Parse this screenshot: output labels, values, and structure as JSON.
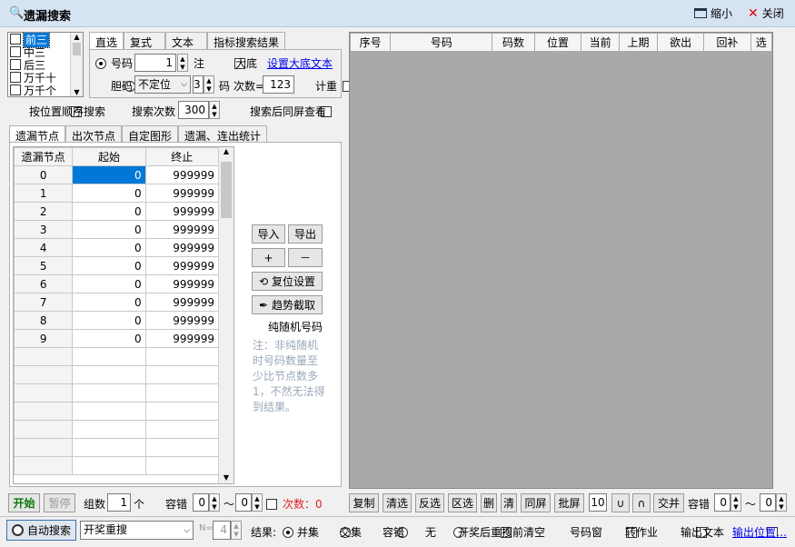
{
  "window": {
    "title": "遗漏搜索",
    "minimize_label": "缩小",
    "close_label": "关闭"
  },
  "list_items": [
    "前三",
    "中三",
    "后三",
    "万千十",
    "万千个"
  ],
  "tabs_top": [
    "直选",
    "复式",
    "文本",
    "指标搜索结果"
  ],
  "mode": {
    "code_label": "号码",
    "code_value": "1",
    "zhu_label": "注",
    "dadi_label": "大底",
    "dadi_link": "设置大底文本",
    "dan_label": "胆码",
    "dan_select": "不定位",
    "dan_num": "3",
    "ma_label": "码",
    "count_label": "次数=",
    "count_value": "123",
    "jizhong_label": "计重"
  },
  "options": {
    "order_label": "按位置顺序搜索",
    "search_count_label": "搜索次数",
    "search_count_value": "300",
    "after_label": "搜索后同屏查看"
  },
  "tabs_mid": [
    "遗漏节点",
    "出次节点",
    "自定图形",
    "遗漏、连出统计"
  ],
  "node_table": {
    "headers": [
      "遗漏节点",
      "起始",
      "终止"
    ],
    "rows": [
      [
        "0",
        "0",
        "999999"
      ],
      [
        "1",
        "0",
        "999999"
      ],
      [
        "2",
        "0",
        "999999"
      ],
      [
        "3",
        "0",
        "999999"
      ],
      [
        "4",
        "0",
        "999999"
      ],
      [
        "5",
        "0",
        "999999"
      ],
      [
        "6",
        "0",
        "999999"
      ],
      [
        "7",
        "0",
        "999999"
      ],
      [
        "8",
        "0",
        "999999"
      ],
      [
        "9",
        "0",
        "999999"
      ]
    ]
  },
  "side_buttons": {
    "import": "导入",
    "export": "导出",
    "plus": "+",
    "minus": "－",
    "reset": "复位设置",
    "trend": "趋势截取",
    "random_label": "纯随机号码",
    "note": "注：非纯随机时号码数量至少比节点数多1，不然无法得到结果。"
  },
  "result_table": {
    "headers": [
      "序号",
      "号码",
      "码数",
      "位置",
      "当前",
      "上期",
      "欲出",
      "回补",
      "选"
    ]
  },
  "left_bottom": {
    "start": "开始",
    "pause": "暂停",
    "group_label": "组数",
    "group_value": "1",
    "ge_label": "个",
    "rongcuo_label": "容错",
    "rc_from": "0",
    "tilde": "～",
    "rc_to": "0",
    "count_text": "次数：0"
  },
  "right_bottom": {
    "buttons": [
      "复制",
      "清选",
      "反选",
      "区选",
      "删",
      "清",
      "同屏",
      "批屏"
    ],
    "pi_value": "10",
    "union": "∪",
    "intersect": "∩",
    "merge": "交并",
    "rongcuo_label": "容错",
    "rc_from": "0",
    "tilde": "～",
    "rc_to": "0"
  },
  "status": {
    "auto_search": "自动搜索",
    "mode_select": "开奖重搜",
    "n_label": "N=",
    "n_value": "4",
    "result_label": "结果:",
    "r_union": "并集",
    "r_intersect": "交集",
    "r_rongcuo": "容错",
    "r_none": "无",
    "clear_label": "开奖后重搜前清空",
    "codewin_label": "号码窗",
    "job_label": "转作业",
    "output_label": "输出文本",
    "output_link": "输出位置…"
  }
}
